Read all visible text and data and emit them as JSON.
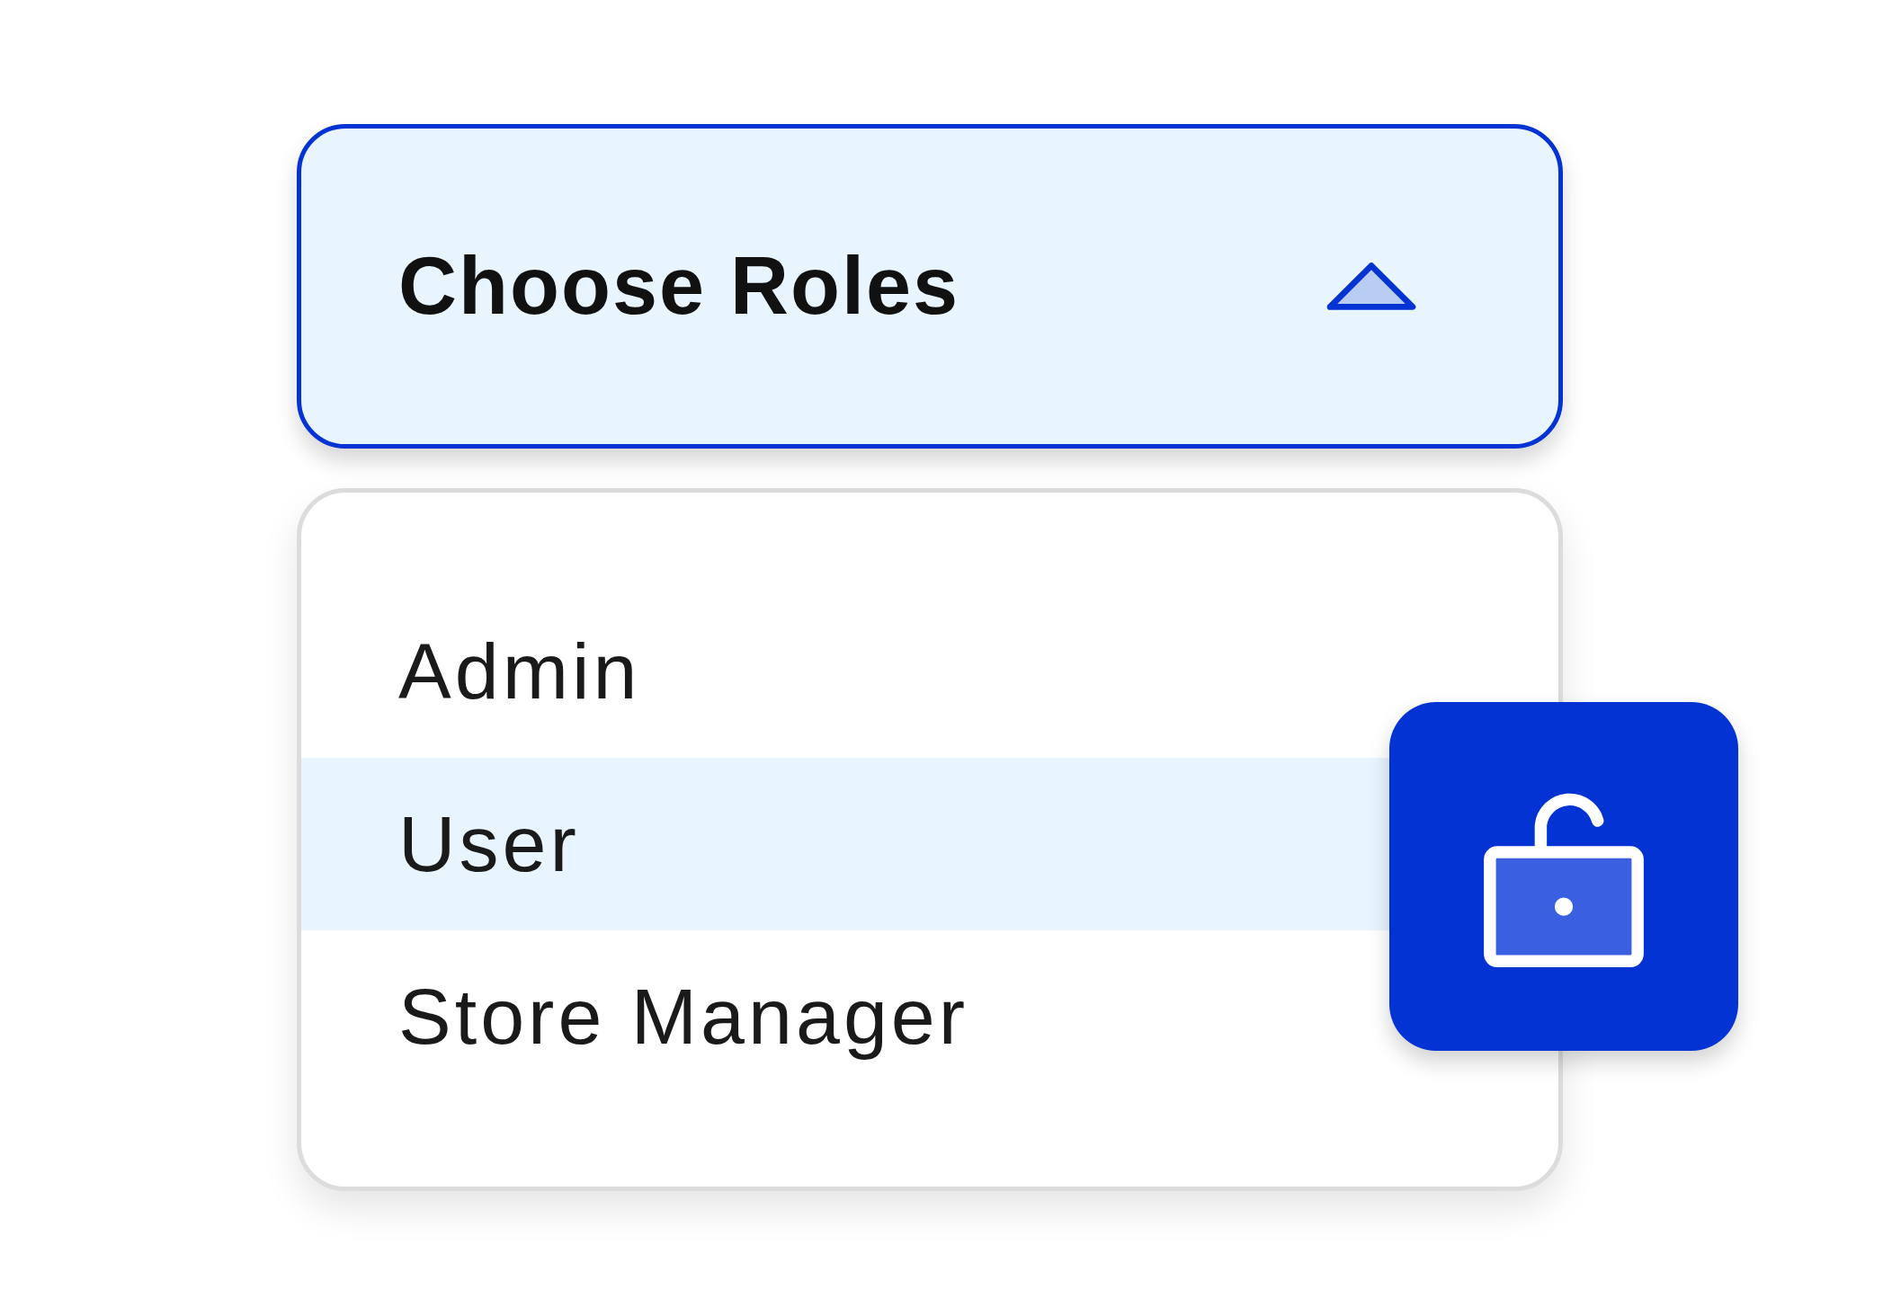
{
  "dropdown": {
    "label": "Choose Roles",
    "expanded": true
  },
  "options": [
    {
      "label": "Admin",
      "selected": false
    },
    {
      "label": "User",
      "selected": true
    },
    {
      "label": "Store Manager",
      "selected": false
    }
  ]
}
